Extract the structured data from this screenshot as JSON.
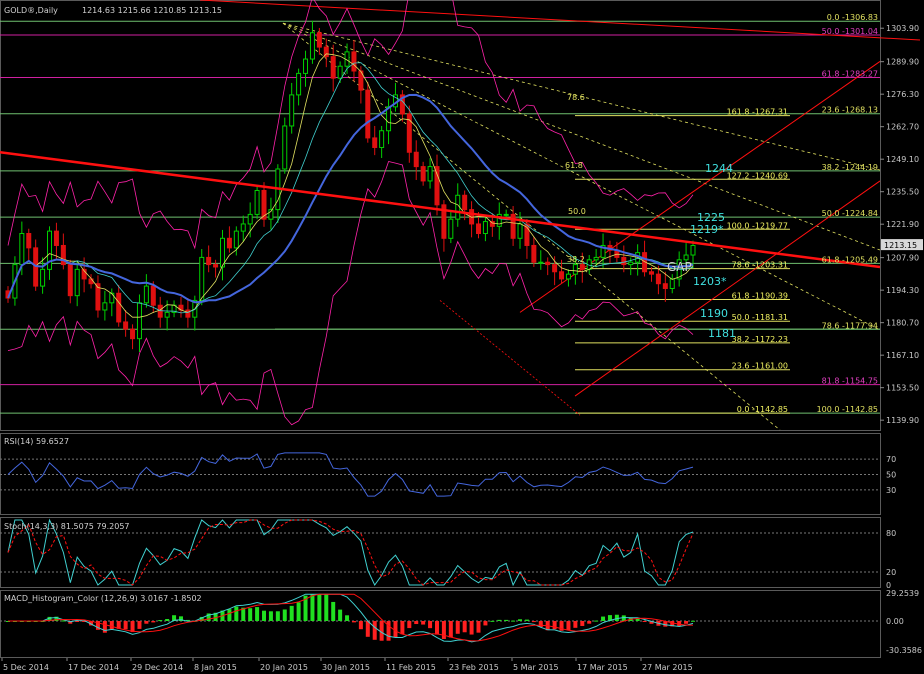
{
  "header": {
    "symbol_title": "GOLD®,Daily",
    "ohlc": "1214.63 1215.66 1210.85 1213.15"
  },
  "colors": {
    "background": "#000000",
    "grid": "#3a3a3a",
    "bull": "#00d000",
    "bear": "#e01010",
    "fib": "#e0e060",
    "fib_ret_line": "#8fdc8f",
    "ma_blue": "#4466dd",
    "ma_red": "#ff1010",
    "bands": "#ff22aa",
    "cyan_text": "#40e0e0",
    "macd_pos": "#20e020",
    "macd_neg": "#ff2020"
  },
  "price_axis": {
    "labels": [
      "1303.90",
      "1289.90",
      "1276.30",
      "1262.70",
      "1249.10",
      "1235.50",
      "1221.90",
      "1207.90",
      "1194.30",
      "1180.70",
      "1167.10",
      "1153.50",
      "1139.90"
    ],
    "current": "1213.15"
  },
  "time_axis": {
    "labels": [
      "5 Dec 2014",
      "17 Dec 2014",
      "29 Dec 2014",
      "8 Jan 2015",
      "20 Jan 2015",
      "30 Jan 2015",
      "11 Feb 2015",
      "23 Feb 2015",
      "5 Mar 2015",
      "17 Mar 2015",
      "27 Mar 2015"
    ]
  },
  "fib_upper_right": [
    "0.0 -1306.83",
    "50.0 -1301.04",
    "61.8 -1283.27",
    "23.6 -1268.13",
    "38.2 -1244.19",
    "50.0 -1224.84",
    "61.8 -1205.49",
    "78.6 -1177.94",
    "81.8 -1154.75",
    "100.0 -1142.85"
  ],
  "fib_inner": [
    "161.8 -1267.31",
    "127.2 -1240.69",
    "100.0 -1219.77",
    "78.6 -1203.31",
    "61.8 -1190.39",
    "50.0 -1181.31",
    "38.2 -1172.23",
    "23.6 -1161.00",
    "0.0 -1142.85"
  ],
  "fan_labels": [
    "78.6",
    "61.8",
    "50.0",
    "38.2"
  ],
  "annotations": {
    "a1244": "1244",
    "a1225": "1225",
    "a1219": "1219*",
    "gap": "GAP",
    "a1203": "1203*",
    "a1190": "1190",
    "a1181": "1181"
  },
  "rsi": {
    "title": "RSI(14) 59.6527",
    "levels": [
      "70",
      "50",
      "30"
    ],
    "value": 59.6527
  },
  "stoch": {
    "title": "Stoch(14,3,3) 81.5075 79.2057",
    "levels": [
      "80",
      "20",
      "0"
    ],
    "k": 81.5075,
    "d": 79.2057
  },
  "macd": {
    "title": "MACD_Histogram_Color (12,26,9)  3.0167 -1.8502",
    "levels": [
      "29.2539",
      "0.00",
      "-30.3586"
    ]
  },
  "chart_data": {
    "type": "candlestick",
    "title": "GOLD®,Daily",
    "y_range": [
      1135,
      1312
    ],
    "last_close": 1213.15,
    "dates_labeled": [
      "5 Dec 2014",
      "17 Dec 2014",
      "29 Dec 2014",
      "8 Jan 2015",
      "20 Jan 2015",
      "30 Jan 2015",
      "11 Feb 2015",
      "23 Feb 2015",
      "5 Mar 2015",
      "17 Mar 2015",
      "27 Mar 2015"
    ],
    "closes": [
      1191,
      1205,
      1218,
      1212,
      1196,
      1203,
      1219,
      1213,
      1205,
      1192,
      1203,
      1199,
      1197,
      1186,
      1189,
      1193,
      1181,
      1178,
      1174,
      1189,
      1196,
      1188,
      1183,
      1185,
      1188,
      1186,
      1183,
      1190,
      1208,
      1205,
      1204,
      1216,
      1212,
      1219,
      1222,
      1226,
      1236,
      1224,
      1228,
      1245,
      1263,
      1276,
      1285,
      1291,
      1302,
      1296,
      1292,
      1283,
      1288,
      1294,
      1286,
      1278,
      1258,
      1254,
      1261,
      1271,
      1276,
      1268,
      1252,
      1246,
      1240,
      1246,
      1230,
      1216,
      1224,
      1234,
      1228,
      1222,
      1218,
      1223,
      1221,
      1226,
      1226,
      1216,
      1222,
      1213,
      1206,
      1206,
      1205,
      1202,
      1199,
      1201,
      1205,
      1203,
      1207,
      1208,
      1213,
      1211,
      1208,
      1205,
      1206,
      1210,
      1202,
      1201,
      1197,
      1195,
      1199,
      1207,
      1209,
      1213
    ]
  }
}
